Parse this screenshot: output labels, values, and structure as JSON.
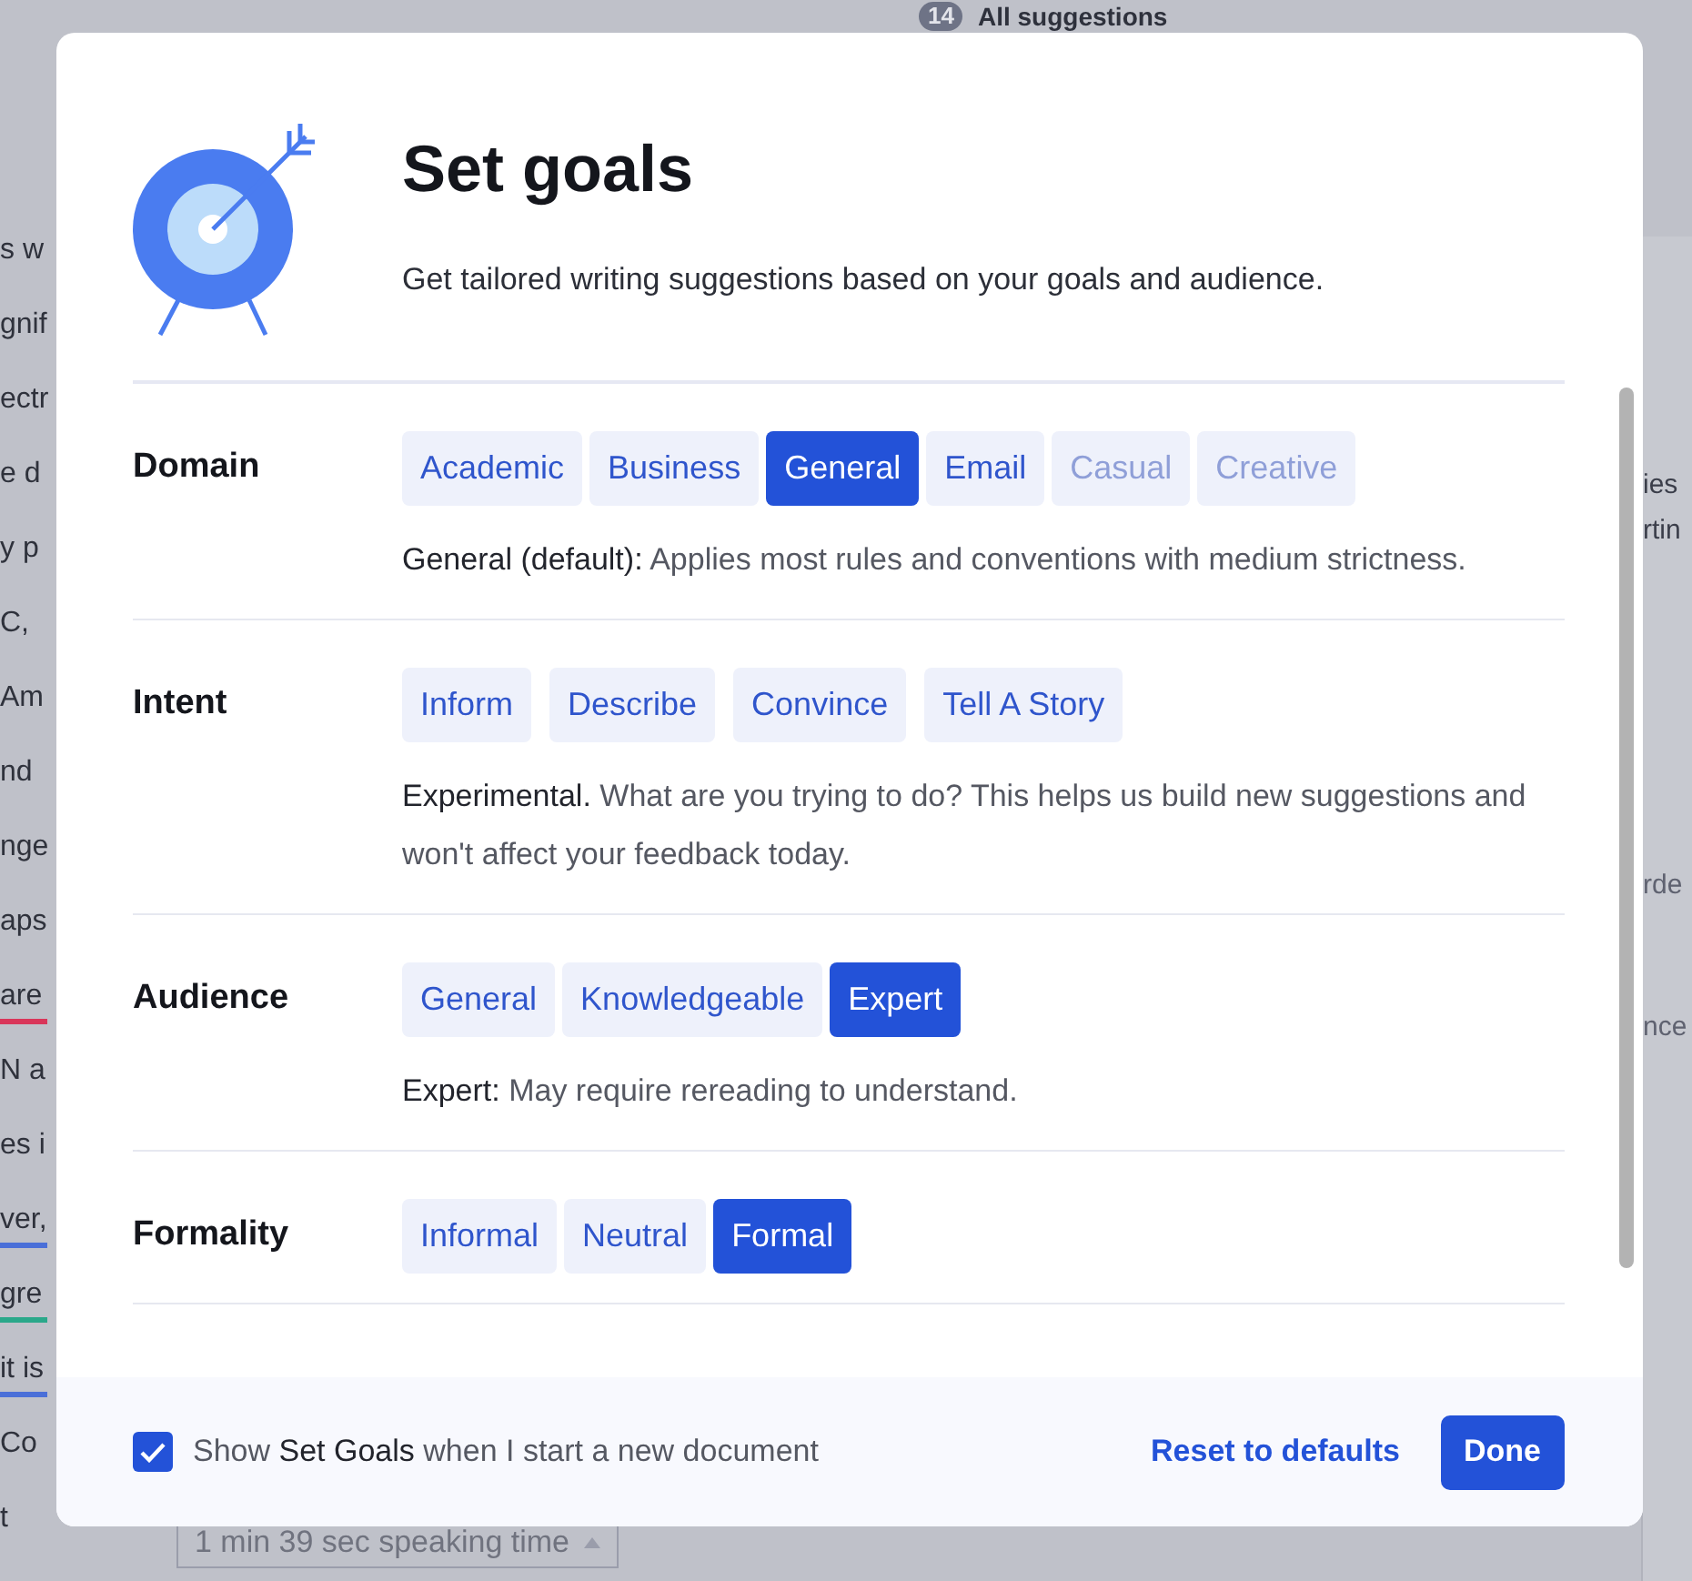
{
  "background": {
    "header": {
      "badge": "14",
      "title": "All suggestions"
    },
    "text_lines": [
      {
        "text": "s w"
      },
      {
        "text": "gnif"
      },
      {
        "text": "ectr"
      },
      {
        "text": "e d"
      },
      {
        "text": "y p"
      },
      {
        "text": "C,"
      },
      {
        "text": "Am"
      },
      {
        "text": "nd"
      },
      {
        "text": "nge"
      },
      {
        "text": "aps"
      },
      {
        "text": "are",
        "color": "#d9365a"
      },
      {
        "text": "N a"
      },
      {
        "text": "es i"
      },
      {
        "text": "ver,",
        "color": "#4a6fd8"
      },
      {
        "text": "gre",
        "color": "#2aa88a"
      },
      {
        "text": "it is",
        "color": "#4a6fd8"
      },
      {
        "text": "Co"
      },
      {
        "text": "t"
      }
    ],
    "speaking_time": "1 min 39 sec speaking time",
    "side_fragments": [
      "ies",
      "rtin",
      "rde",
      "nce"
    ]
  },
  "dialog": {
    "title": "Set goals",
    "subtitle": "Get tailored writing suggestions based on your goals and audience.",
    "sections": [
      {
        "label": "Domain",
        "kind": "segmented",
        "options": [
          {
            "label": "Academic",
            "selected": false,
            "disabled": false
          },
          {
            "label": "Business",
            "selected": false,
            "disabled": false
          },
          {
            "label": "General",
            "selected": true,
            "disabled": false
          },
          {
            "label": "Email",
            "selected": false,
            "disabled": false
          },
          {
            "label": "Casual",
            "selected": false,
            "disabled": true
          },
          {
            "label": "Creative",
            "selected": false,
            "disabled": true
          }
        ],
        "lead": "General (default):",
        "text": "Applies most rules and conventions with medium strictness."
      },
      {
        "label": "Intent",
        "kind": "separate",
        "options": [
          {
            "label": "Inform",
            "selected": false,
            "disabled": false
          },
          {
            "label": "Describe",
            "selected": false,
            "disabled": false
          },
          {
            "label": "Convince",
            "selected": false,
            "disabled": false
          },
          {
            "label": "Tell A Story",
            "selected": false,
            "disabled": false
          }
        ],
        "lead": "Experimental.",
        "text": "What are you trying to do? This helps us build new suggestions and won't affect your feedback today."
      },
      {
        "label": "Audience",
        "kind": "segmented",
        "options": [
          {
            "label": "General",
            "selected": false,
            "disabled": false
          },
          {
            "label": "Knowledgeable",
            "selected": false,
            "disabled": false
          },
          {
            "label": "Expert",
            "selected": true,
            "disabled": false
          }
        ],
        "lead": "Expert:",
        "text": "May require rereading to understand."
      },
      {
        "label": "Formality",
        "kind": "segmented",
        "options": [
          {
            "label": "Informal",
            "selected": false,
            "disabled": false
          },
          {
            "label": "Neutral",
            "selected": false,
            "disabled": false
          },
          {
            "label": "Formal",
            "selected": true,
            "disabled": false
          }
        ]
      }
    ],
    "footer": {
      "checkbox": {
        "checked": true,
        "label": "Show **Set Goals** when I start a new document"
      },
      "reset": "Reset to defaults",
      "done": "Done"
    }
  }
}
